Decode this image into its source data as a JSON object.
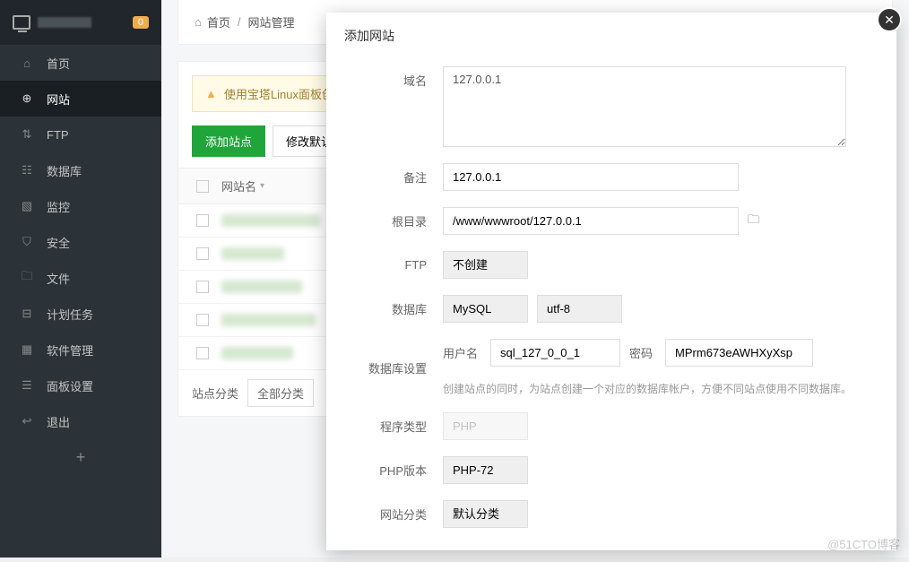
{
  "header": {
    "badge": "0"
  },
  "sidebar": {
    "items": [
      {
        "label": "首页",
        "icon": "home"
      },
      {
        "label": "网站",
        "icon": "globe"
      },
      {
        "label": "FTP",
        "icon": "ftp"
      },
      {
        "label": "数据库",
        "icon": "database"
      },
      {
        "label": "监控",
        "icon": "monitor"
      },
      {
        "label": "安全",
        "icon": "shield"
      },
      {
        "label": "文件",
        "icon": "folder"
      },
      {
        "label": "计划任务",
        "icon": "calendar"
      },
      {
        "label": "软件管理",
        "icon": "apps"
      },
      {
        "label": "面板设置",
        "icon": "settings"
      },
      {
        "label": "退出",
        "icon": "exit"
      }
    ]
  },
  "breadcrumb": {
    "home": "首页",
    "sep": "/",
    "current": "网站管理"
  },
  "warning": "使用宝塔Linux面板创",
  "toolbar": {
    "add": "添加站点",
    "default_page": "修改默认页"
  },
  "table": {
    "col_site": "网站名"
  },
  "footer": {
    "cat_label": "站点分类",
    "cat_value": "全部分类"
  },
  "modal": {
    "title": "添加网站",
    "labels": {
      "domain": "域名",
      "remark": "备注",
      "root": "根目录",
      "ftp": "FTP",
      "db": "数据库",
      "db_settings": "数据库设置",
      "db_user": "用户名",
      "db_pass": "密码",
      "program": "程序类型",
      "php_ver": "PHP版本",
      "category": "网站分类"
    },
    "values": {
      "domain": "127.0.0.1",
      "remark": "127.0.0.1",
      "root": "/www/wwwroot/127.0.0.1",
      "ftp": "不创建",
      "db": "MySQL",
      "charset": "utf-8",
      "db_user": "sql_127_0_0_1",
      "db_pass": "MPrm673eAWHXyXsp",
      "program": "PHP",
      "php_ver": "PHP-72",
      "category": "默认分类"
    },
    "hint": "创建站点的同时，为站点创建一个对应的数据库帐户，方便不同站点使用不同数据库。"
  },
  "watermark": "@51CTO博客"
}
